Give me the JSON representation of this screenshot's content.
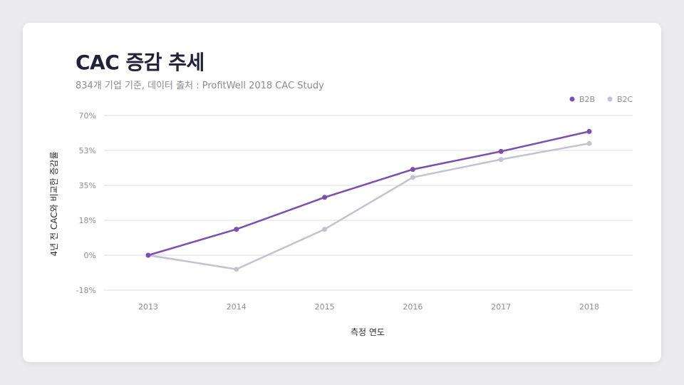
{
  "title": "CAC 증감 추세",
  "subtitle": "834개 기업 기준, 데이터 출처 : ProfitWell 2018 CAC Study",
  "chart_data": {
    "type": "line",
    "x": [
      "2013",
      "2014",
      "2015",
      "2016",
      "2017",
      "2018"
    ],
    "xlabel": "측정 연도",
    "ylabel": "4년 전 CAC와 비교한 증감률",
    "yticks": [
      "-18%",
      "0%",
      "18%",
      "35%",
      "53%",
      "70%"
    ],
    "ytick_values": [
      -17.5,
      0,
      17.5,
      35,
      52.5,
      70
    ],
    "ylim": [
      -17.5,
      70
    ],
    "grid": true,
    "legend_position": "top-right",
    "series": [
      {
        "name": "B2B",
        "color": "#7b4fb0",
        "values": [
          0,
          13,
          29,
          43,
          52,
          62
        ]
      },
      {
        "name": "B2C",
        "color": "#c4c1d2",
        "values": [
          0,
          -7,
          13,
          39,
          48,
          56
        ]
      }
    ]
  }
}
